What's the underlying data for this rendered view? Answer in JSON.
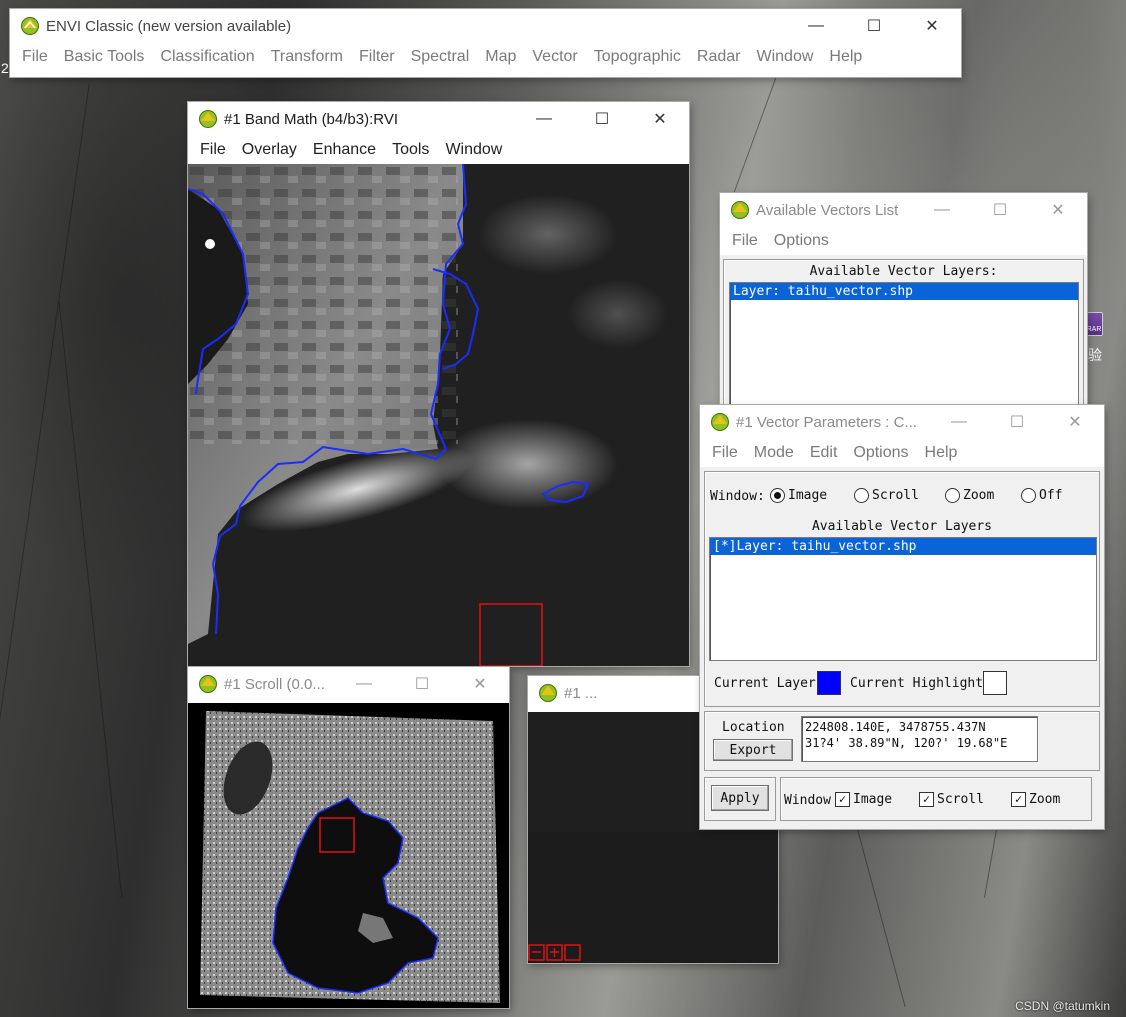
{
  "desktop": {
    "watermark": "CSDN @tatumkin",
    "left_edge_char": "2",
    "right_edge_text": "验",
    "rar_icon_label": "RAR"
  },
  "envi_main": {
    "title": "ENVI Classic (new version available)",
    "menu": [
      "File",
      "Basic Tools",
      "Classification",
      "Transform",
      "Filter",
      "Spectral",
      "Map",
      "Vector",
      "Topographic",
      "Radar",
      "Window",
      "Help"
    ]
  },
  "image_window": {
    "title": "#1 Band Math (b4/b3):RVI",
    "menu": [
      "File",
      "Overlay",
      "Enhance",
      "Tools",
      "Window"
    ]
  },
  "scroll_window": {
    "title": "#1 Scroll (0.0..."
  },
  "zoom_window": {
    "title": "#1 ..."
  },
  "vectors_list": {
    "title": "Available Vectors List",
    "menu": [
      "File",
      "Options"
    ],
    "header": "Available Vector Layers:",
    "layers": [
      "Layer: taihu_vector.shp"
    ]
  },
  "vector_params": {
    "title": "#1 Vector Parameters : C...",
    "menu": [
      "File",
      "Mode",
      "Edit",
      "Options",
      "Help"
    ],
    "window_label": "Window:",
    "window_options": [
      "Image",
      "Scroll",
      "Zoom",
      "Off"
    ],
    "window_selected": "Image",
    "list_header": "Available Vector Layers",
    "layers": [
      "[*]Layer: taihu_vector.shp"
    ],
    "current_layer_label": "Current Layer",
    "current_layer_color": "#0000ff",
    "current_highlight_label": "Current Highlight",
    "current_highlight_color": "#ffffff",
    "location_label": "Location",
    "export_label": "Export",
    "location_line1": "224808.140E, 3478755.437N",
    "location_line2": "31?4' 38.89\"N, 120?' 19.68\"E",
    "apply_label": "Apply",
    "apply_window_label": "Window",
    "apply_checks": [
      "Image",
      "Scroll",
      "Zoom"
    ]
  },
  "colors": {
    "vector": "#1a2cff",
    "zoom_box": "#e01010",
    "selection": "#0a64d8"
  }
}
